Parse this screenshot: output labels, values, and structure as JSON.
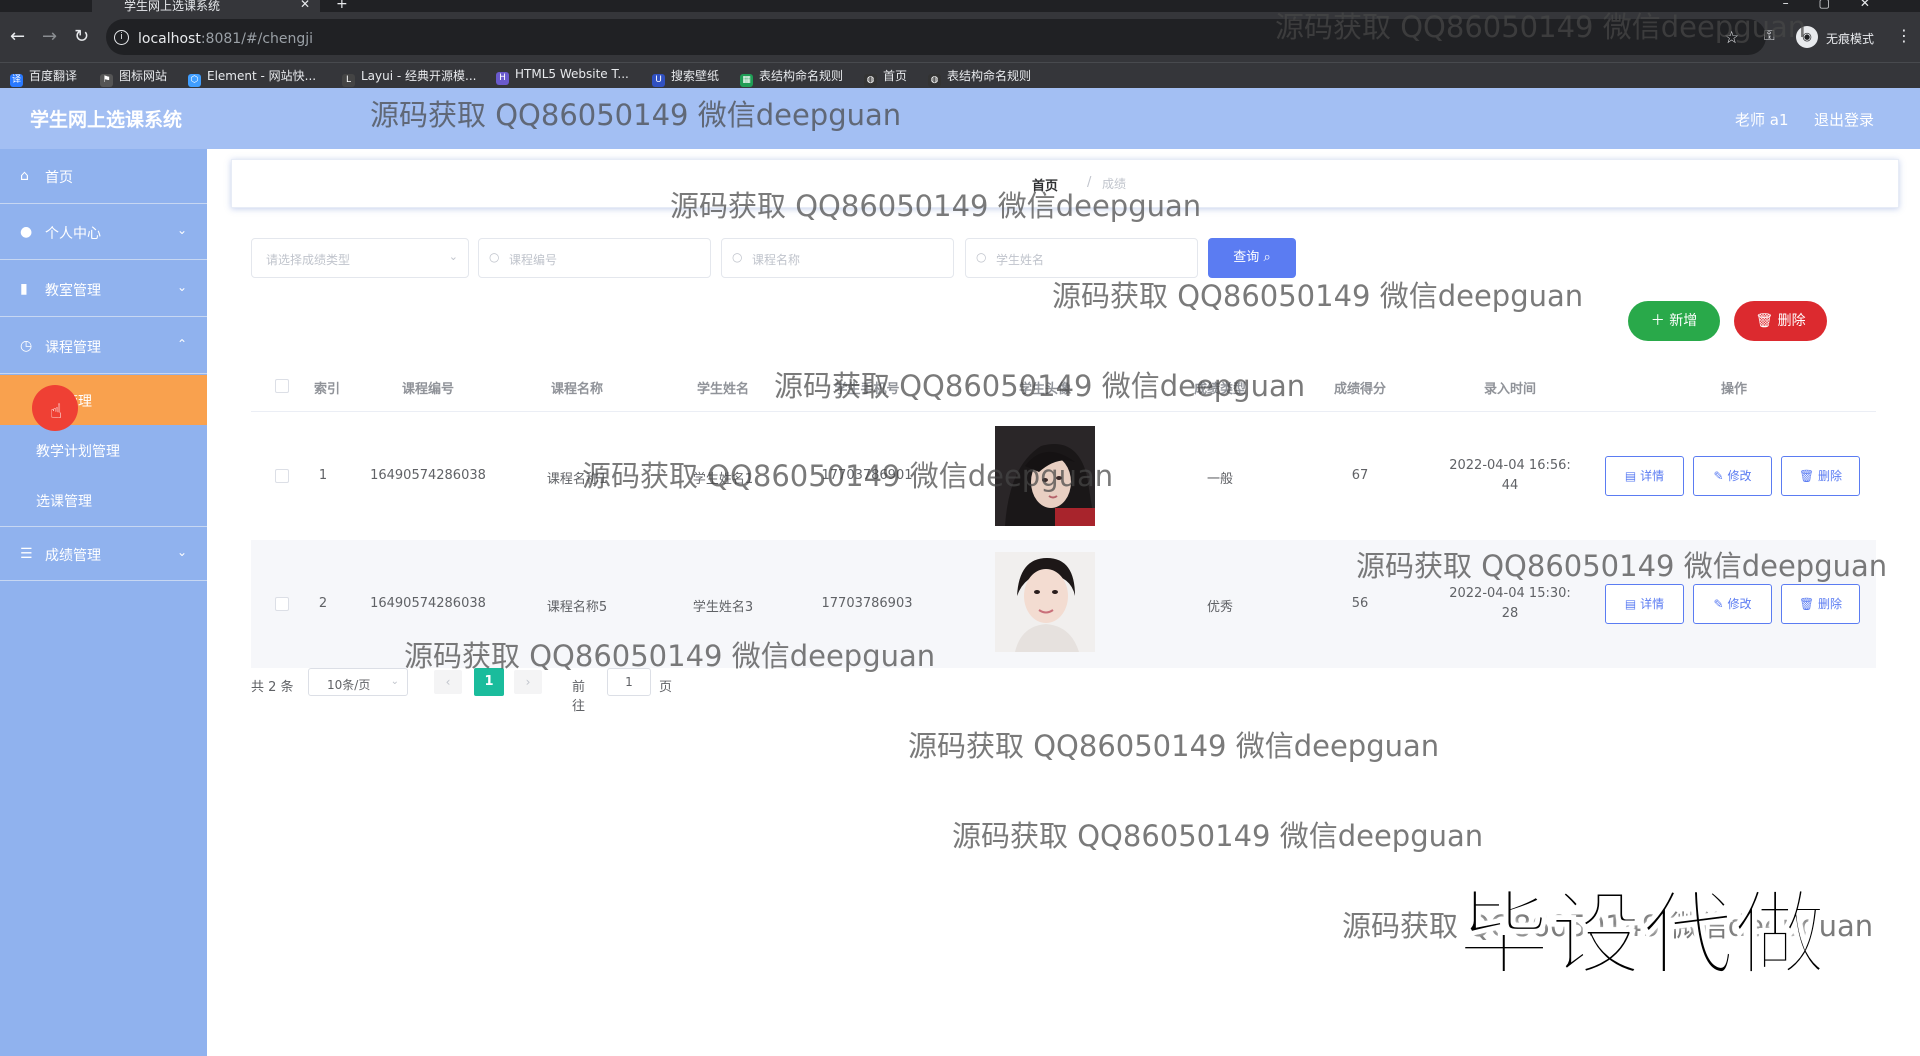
{
  "browser": {
    "tab_title": "学生网上选课系统",
    "url_host": "localhost",
    "url_rest": ":8081/#/chengji",
    "incognito_label": "无痕模式",
    "bookmarks": [
      "百度翻译",
      "图标网站",
      "Element - 网站快...",
      "Layui - 经典开源模...",
      "HTML5 Website T...",
      "搜索壁纸",
      "表结构命名规则",
      "首页",
      "表结构命名规则"
    ]
  },
  "header": {
    "title": "学生网上选课系统",
    "user": "老师 a1",
    "logout": "退出登录"
  },
  "sidebar": {
    "items": [
      {
        "label": "首页",
        "icon": "home-icon"
      },
      {
        "label": "个人中心",
        "icon": "user-icon"
      },
      {
        "label": "教室管理",
        "icon": "chart-icon"
      },
      {
        "label": "课程管理",
        "icon": "clock-icon"
      }
    ],
    "sub_items": [
      "课程管理",
      "教学计划管理",
      "选课管理"
    ],
    "last_item": {
      "label": "成绩管理",
      "icon": "db-icon"
    }
  },
  "breadcrumb": {
    "home": "首页",
    "sep": "/",
    "current": "成绩"
  },
  "search": {
    "type_placeholder": "请选择成绩类型",
    "course_no_placeholder": "课程编号",
    "course_name_placeholder": "课程名称",
    "student_name_placeholder": "学生姓名",
    "query_label": "查询"
  },
  "actions": {
    "add_label": "新增",
    "delete_label": "删除"
  },
  "table": {
    "headers": [
      "索引",
      "课程编号",
      "课程名称",
      "学生姓名",
      "学生手机号",
      "学生头像",
      "成绩类型",
      "成绩得分",
      "录入时间",
      "操作"
    ],
    "rows": [
      {
        "index": "1",
        "course_no": "16490574286038",
        "course_name": "课程名称1",
        "student": "学生姓名1",
        "phone": "17703786901",
        "type": "一般",
        "score": "67",
        "time1": "2022-04-04 16:56:",
        "time2": "44"
      },
      {
        "index": "2",
        "course_no": "16490574286038",
        "course_name": "课程名称5",
        "student": "学生姓名3",
        "phone": "17703786903",
        "type": "优秀",
        "score": "56",
        "time1": "2022-04-04 15:30:",
        "time2": "28"
      }
    ],
    "op_labels": {
      "detail": "详情",
      "edit": "修改",
      "delete": "删除"
    }
  },
  "pagination": {
    "total": "共 2 条",
    "size": "10条/页",
    "current": "1",
    "goto": "前往",
    "page_input": "1",
    "page_suffix": "页"
  },
  "watermark": "源码获取 QQ86050149 微信deepguan",
  "stamp": "毕设代做"
}
